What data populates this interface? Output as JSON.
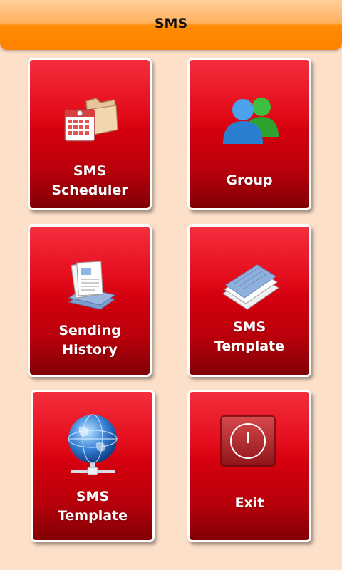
{
  "app": {
    "title": "SMS"
  },
  "tiles": [
    {
      "id": "sms-scheduler",
      "line1": "SMS",
      "line2": "Scheduler",
      "icon": "calendar-folder-icon"
    },
    {
      "id": "group",
      "line1": "Group",
      "line2": "",
      "icon": "users-icon"
    },
    {
      "id": "sending-history",
      "line1": "Sending",
      "line2": "History",
      "icon": "documents-stack-icon"
    },
    {
      "id": "sms-template-1",
      "line1": "SMS",
      "line2": "Template",
      "icon": "papers-icon"
    },
    {
      "id": "sms-template-2",
      "line1": "SMS",
      "line2": "Template",
      "icon": "globe-network-icon"
    },
    {
      "id": "exit",
      "line1": "Exit",
      "line2": "",
      "icon": "power-icon"
    }
  ],
  "colors": {
    "titlebar": "#ff8a00",
    "tile": "#e20010",
    "background": "#fde0c9"
  }
}
